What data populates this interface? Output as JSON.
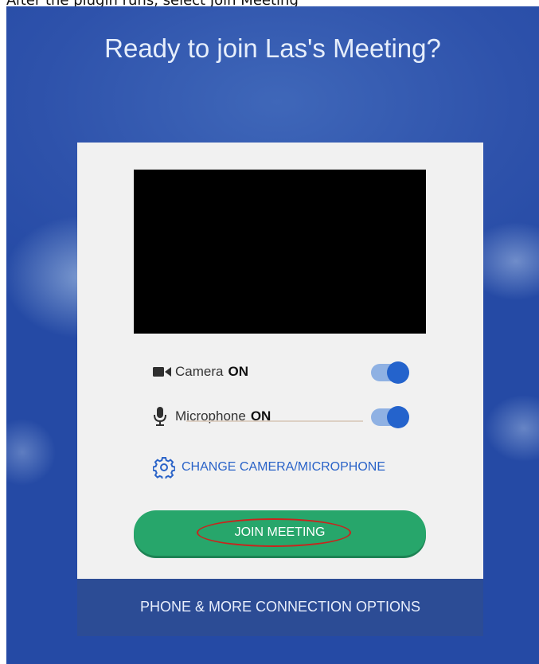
{
  "caption": "After the plugin runs, select Join Meeting",
  "title": "Ready to join Las's Meeting?",
  "camera": {
    "label": "Camera",
    "status": "ON",
    "icon": "video-camera-icon"
  },
  "microphone": {
    "label": "Microphone",
    "status": "ON",
    "icon": "microphone-icon"
  },
  "change_devices": {
    "label": "CHANGE CAMERA/MICROPHONE",
    "icon": "gear-icon"
  },
  "join_button": {
    "label": "JOIN MEETING"
  },
  "connection_options": {
    "label": "PHONE & MORE CONNECTION OPTIONS"
  },
  "colors": {
    "background": "#2e52ab",
    "join_green": "#27a66b",
    "toggle_blue": "#2463cc",
    "link_blue": "#2a63c8",
    "footer": "#2c4c95"
  }
}
